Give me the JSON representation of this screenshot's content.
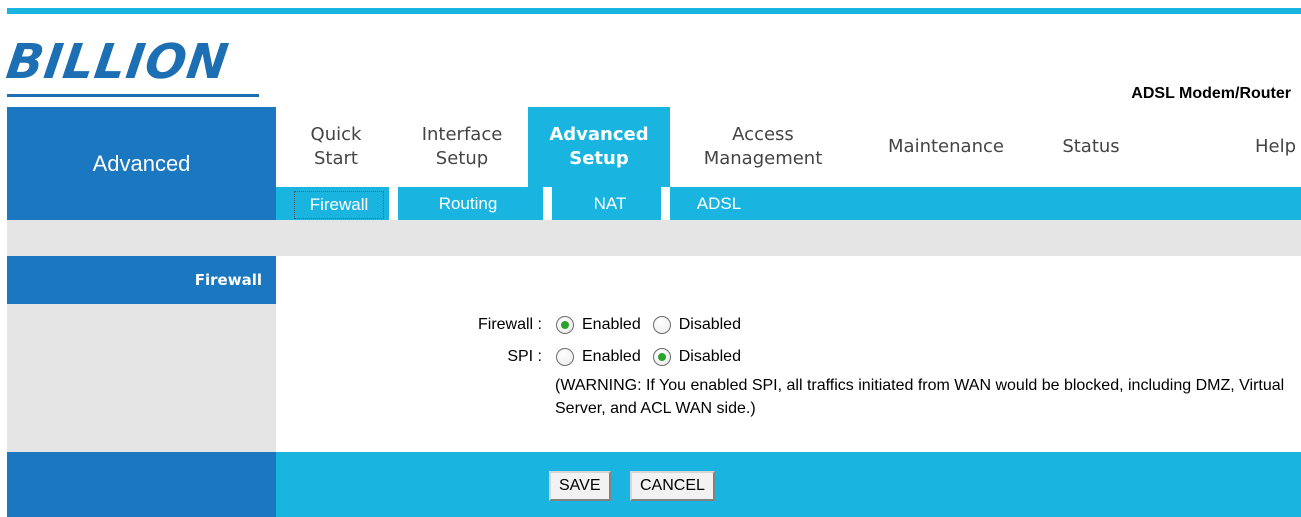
{
  "brand": {
    "logo_text": "BILLION",
    "product": "ADSL Modem/Router"
  },
  "section_title": "Advanced",
  "nav": {
    "quick_start": "Quick\nStart",
    "interface_setup": "Interface\nSetup",
    "advanced_setup": "Advanced\nSetup",
    "access_management": "Access\nManagement",
    "maintenance": "Maintenance",
    "status": "Status",
    "help": "Help"
  },
  "subnav": {
    "firewall": "Firewall",
    "routing": "Routing",
    "nat": "NAT",
    "adsl": "ADSL"
  },
  "side": {
    "firewall_header": "Firewall"
  },
  "form": {
    "firewall_label": "Firewall :",
    "firewall_value": "Enabled",
    "spi_label": "SPI :",
    "spi_value": "Disabled",
    "enabled": "Enabled",
    "disabled": "Disabled",
    "warning": "(WARNING: If You enabled SPI, all traffics initiated from WAN would be blocked, including DMZ, Virtual Server, and ACL WAN side.)"
  },
  "buttons": {
    "save": "SAVE",
    "cancel": "CANCEL"
  },
  "colors": {
    "primary_blue": "#1a77c0",
    "accent_cyan": "#19b5e0",
    "panel_gray": "#e5e5e5",
    "radio_selected": "#2aa32a"
  }
}
